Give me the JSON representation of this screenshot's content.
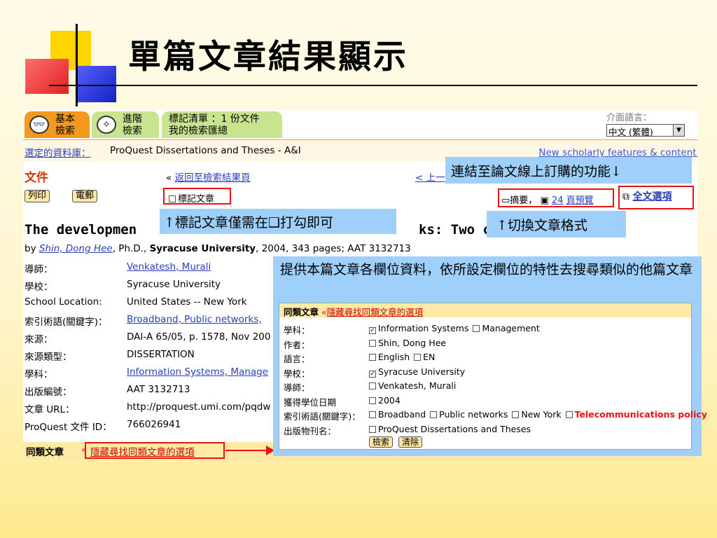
{
  "slide": {
    "title": "單篇文章結果顯示"
  },
  "tabs": {
    "basic_1": "基本",
    "basic_2": "檢索",
    "adv_1": "進階",
    "adv_2": "檢索",
    "mark_1": "標記清單 ：1 份文件",
    "mark_2": "我的檢索匯總"
  },
  "lang": {
    "label": "介面語言：",
    "value": "中文 (繁體)"
  },
  "db": {
    "label": "選定的資料庫：",
    "name": "ProQuest Dissertations and Theses - A&I",
    "new_features": "New scholarly features & content!"
  },
  "doc": {
    "heading": "文件",
    "back_prefix": "«",
    "back_link": "返回至檢索結果頁",
    "prev": "< 上一",
    "print": "列印",
    "email": "電郵",
    "mark": "標記文章",
    "abstract_lbl": "摘要，",
    "pages_prefix": "24",
    "pages_link": "頁預覽",
    "fulltext": "全文選項"
  },
  "article": {
    "title_left": "The developmen",
    "title_right": "ks: Two cas",
    "by": "by",
    "author": "Shin, Dong Hee",
    "byline_rest": ", Ph.D.,",
    "university": "Syracuse University",
    "byline_tail": ", 2004, 343 pages; AAT 3132713"
  },
  "meta": [
    {
      "label": "導師：",
      "value": "Venkatesh, Murali",
      "link": true
    },
    {
      "label": "學校：",
      "value": "Syracuse University",
      "link": false
    },
    {
      "label": "School Location:",
      "value": "United States -- New York",
      "link": false
    },
    {
      "label": "索引術語(關鍵字)：",
      "value": "Broadband,  Public networks,",
      "link": true
    },
    {
      "label": "來源：",
      "value": "DAI-A 65/05, p. 1578, Nov 200",
      "link": false
    },
    {
      "label": "來源類型：",
      "value": "DISSERTATION",
      "link": false
    },
    {
      "label": "學科：",
      "value": "Information Systems,  Manage",
      "link": true
    },
    {
      "label": "出版編號：",
      "value": "AAT 3132713",
      "link": false
    },
    {
      "label": "文章 URL：",
      "value": "http://proquest.umi.com/pqdw",
      "link": false
    },
    {
      "label": "ProQuest 文件 ID：",
      "value": "766026941",
      "link": false
    }
  ],
  "similar": {
    "label": "同類文章",
    "arrow": "«",
    "link": "隱藏尋找同類文章的選項"
  },
  "callouts": {
    "subscribe": "連結至論文線上訂購的功能↓",
    "mark": "↑標記文章僅需在❑打勾即可",
    "format": "↑切換文章格式",
    "panel": "提供本篇文章各欄位資料，依所設定欄位的特性去搜尋類似的他篇文章"
  },
  "panel": {
    "head_label": "同類文章",
    "head_link": "隱藏尋找同類文章的選項",
    "rows": [
      {
        "label": "學科：",
        "items": [
          {
            "t": "Information Systems",
            "c": true
          },
          {
            "t": "Management",
            "c": false
          }
        ]
      },
      {
        "label": "作者：",
        "items": [
          {
            "t": "Shin, Dong Hee",
            "c": false
          }
        ]
      },
      {
        "label": "語言：",
        "items": [
          {
            "t": "English",
            "c": false
          },
          {
            "t": "EN",
            "c": false
          }
        ]
      },
      {
        "label": "學校：",
        "items": [
          {
            "t": "Syracuse University",
            "c": true
          }
        ]
      },
      {
        "label": "導師：",
        "items": [
          {
            "t": "Venkatesh, Murali",
            "c": false
          }
        ]
      },
      {
        "label": "獲得學位日期",
        "items": [
          {
            "t": "2004",
            "c": false
          }
        ]
      },
      {
        "label": "索引術語(關鍵字)：",
        "items": [
          {
            "t": "Broadband",
            "c": false
          },
          {
            "t": "Public networks",
            "c": false
          },
          {
            "t": "New York",
            "c": false
          },
          {
            "t": "Telecommunications policy",
            "c": false,
            "red": true
          }
        ]
      },
      {
        "label": "出版物刊名：",
        "items": [
          {
            "t": "ProQuest Dissertations and Theses",
            "c": false
          }
        ]
      }
    ],
    "search": "檢索",
    "clear": "清除"
  },
  "colors": {
    "accent_red": "#e11111",
    "link_blue": "#2a3fb7",
    "callout_blue": "#9fd0fb",
    "tab_orange": "#f39a1e",
    "tab_green": "#c9e48f"
  }
}
